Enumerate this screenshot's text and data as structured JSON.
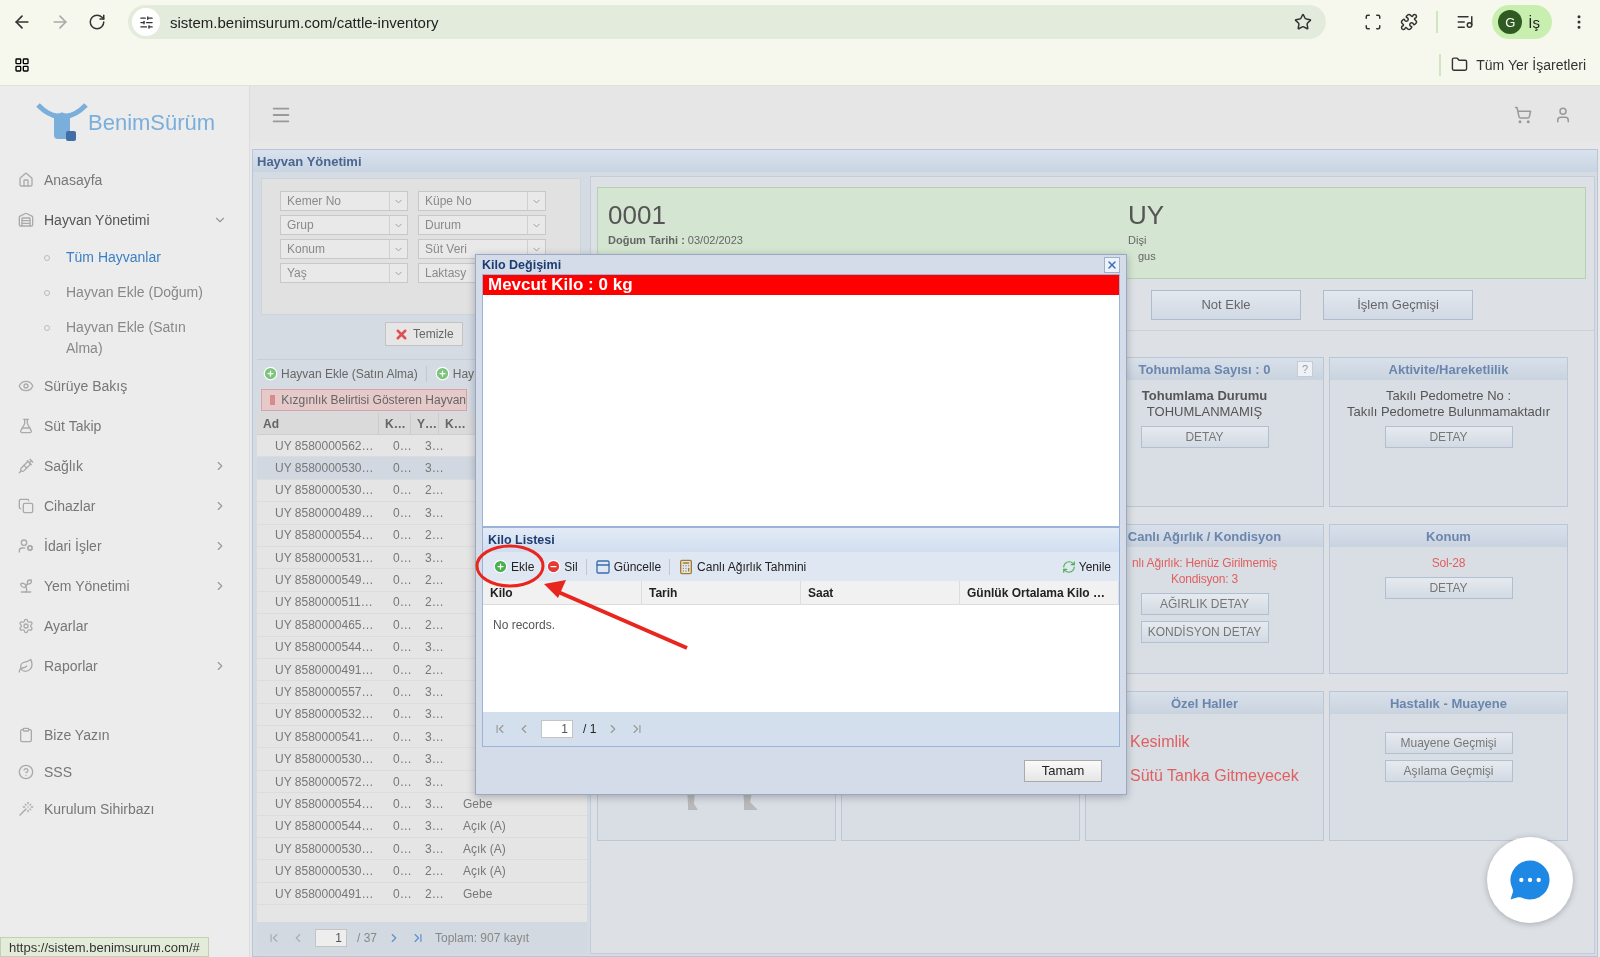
{
  "browser": {
    "url": "sistem.benimsurum.com/cattle-inventory",
    "profile_initial": "G",
    "profile_label": "İş",
    "bookmarks_folder": "Tüm Yer İşaretleri",
    "status_url": "https://sistem.benimsurum.com/#"
  },
  "logo": {
    "part_a": "Benim",
    "part_b": "Sürüm"
  },
  "sidebar": {
    "items": [
      {
        "kind": "link",
        "label": "Anasayfa"
      },
      {
        "kind": "group",
        "label": "Hayvan Yönetimi",
        "expanded": true,
        "children": [
          {
            "label": "Tüm Hayvanlar",
            "selected": true
          },
          {
            "label": "Hayvan Ekle (Doğum)",
            "selected": false
          },
          {
            "label": "Hayvan Ekle (Satın Alma)",
            "selected": false
          }
        ]
      },
      {
        "kind": "link",
        "label": "Sürüye Bakış"
      },
      {
        "kind": "link",
        "label": "Süt Takip"
      },
      {
        "kind": "group",
        "label": "Sağlık",
        "expanded": false
      },
      {
        "kind": "group",
        "label": "Cihazlar",
        "expanded": false
      },
      {
        "kind": "group",
        "label": "İdari İşler",
        "expanded": false
      },
      {
        "kind": "group",
        "label": "Yem Yönetimi",
        "expanded": false
      },
      {
        "kind": "link",
        "label": "Ayarlar"
      },
      {
        "kind": "group",
        "label": "Raporlar",
        "expanded": false
      }
    ],
    "footer_items": [
      "Bize Yazın",
      "SSS",
      "Kurulum Sihirbazı"
    ]
  },
  "panel": {
    "title": "Hayvan Yönetimi"
  },
  "filters": [
    {
      "placeholder": "Kemer No"
    },
    {
      "placeholder": "Küpe No"
    },
    {
      "placeholder": "Grup"
    },
    {
      "placeholder": "Durum"
    },
    {
      "placeholder": "Konum"
    },
    {
      "placeholder": "Süt Veri"
    },
    {
      "placeholder": "Yaş"
    },
    {
      "placeholder": "Laktasy"
    }
  ],
  "clear_button": "Temizle",
  "list_toolbar": [
    "Hayvan Ekle (Satın Alma)",
    "Hay"
  ],
  "legend": "Kızgınlık Belirtisi Gösteren Hayvan",
  "table": {
    "columns": [
      "Ad",
      "K…",
      "Y…",
      "K…"
    ],
    "rows": [
      {
        "selected": false,
        "cells": [
          "UY 8580000562…",
          "0…",
          "3…"
        ]
      },
      {
        "selected": true,
        "cells": [
          "UY 8580000530…",
          "0…",
          "3…"
        ]
      },
      {
        "selected": false,
        "cells": [
          "UY 8580000530…",
          "0…",
          "2…"
        ]
      },
      {
        "selected": false,
        "cells": [
          "UY 8580000489…",
          "0…",
          "3…"
        ]
      },
      {
        "selected": false,
        "cells": [
          "UY 8580000554…",
          "0…",
          "2…"
        ]
      },
      {
        "selected": false,
        "cells": [
          "UY 8580000531…",
          "0…",
          "3…"
        ]
      },
      {
        "selected": false,
        "cells": [
          "UY 8580000549…",
          "0…",
          "2…"
        ]
      },
      {
        "selected": false,
        "cells": [
          "UY 8580000511…",
          "0…",
          "2…"
        ]
      },
      {
        "selected": false,
        "cells": [
          "UY 8580000465…",
          "0…",
          "2…"
        ]
      },
      {
        "selected": false,
        "cells": [
          "UY 8580000544…",
          "0…",
          "3…"
        ]
      },
      {
        "selected": false,
        "cells": [
          "UY 8580000491…",
          "0…",
          "2…"
        ]
      },
      {
        "selected": false,
        "cells": [
          "UY 8580000557…",
          "0…",
          "3…"
        ]
      },
      {
        "selected": false,
        "cells": [
          "UY 8580000532…",
          "0…",
          "3…"
        ]
      },
      {
        "selected": false,
        "cells": [
          "UY 8580000541…",
          "0…",
          "3…"
        ]
      },
      {
        "selected": false,
        "cells": [
          "UY 8580000530…",
          "0…",
          "3…"
        ]
      },
      {
        "selected": false,
        "cells": [
          "UY 8580000572…",
          "0…",
          "3…"
        ]
      },
      {
        "selected": false,
        "cells": [
          "UY 8580000554…",
          "0…",
          "3…",
          "Gebe"
        ]
      },
      {
        "selected": false,
        "cells": [
          "UY 8580000544…",
          "0…",
          "3…",
          "Açık (A)"
        ]
      },
      {
        "selected": false,
        "cells": [
          "UY 8580000530…",
          "0…",
          "3…",
          "Açık (A)"
        ]
      },
      {
        "selected": false,
        "cells": [
          "UY 8580000530…",
          "0…",
          "2…",
          "Açık (A)"
        ]
      },
      {
        "selected": false,
        "cells": [
          "UY 8580000491…",
          "0…",
          "2…",
          "Gebe"
        ]
      }
    ],
    "pager": {
      "page": "1",
      "of": "/ 37",
      "summary": "Toplam: 907 kayıt"
    }
  },
  "animal": {
    "number": "0001",
    "birth_label": "Doğum Tarihi :",
    "birth_date": "03/02/2023",
    "tag": "UY",
    "sex": "Dişi",
    "line_3": "gus"
  },
  "actions": [
    "Not Ekle",
    "İşlem Geçmişi"
  ],
  "cards": [
    {
      "title": "Tohumlama Sayısı : 0",
      "help": "?",
      "list_style": false,
      "lines": [
        {
          "text": "Tohumlama Durumu",
          "bold": true,
          "warning": false
        },
        {
          "text": "TOHUMLANMAMIŞ",
          "bold": false,
          "warning": false
        }
      ],
      "buttons": [
        "DETAY"
      ]
    },
    {
      "title": "Aktivite/Hareketlilik",
      "list_style": false,
      "lines": [
        {
          "text": "Takılı Pedometre No :",
          "bold": false,
          "warning": false
        },
        {
          "text": "Takılı Pedometre Bulunmamaktadır",
          "bold": false,
          "warning": false
        }
      ],
      "buttons": [
        "DETAY"
      ]
    },
    {
      "title": "Canlı Ağırlık / Kondisyon",
      "list_style": false,
      "lines": [
        {
          "text": "nlı Ağırlık: Henüz Girilmemiş",
          "bold": false,
          "warning": true
        },
        {
          "text": "Kondisyon: 3",
          "bold": false,
          "warning": true
        }
      ],
      "buttons": [
        "AĞIRLIK DETAY",
        "KONDİSYON DETAY"
      ]
    },
    {
      "title": "Konum",
      "list_style": false,
      "lines": [
        {
          "text": "Sol-28",
          "bold": false,
          "warning": true
        }
      ],
      "buttons": [
        "DETAY"
      ]
    },
    {
      "title": "Özel Haller",
      "list_style": true,
      "lines": [
        {
          "text": "Kesimlik",
          "bold": false,
          "warning": true
        },
        {
          "text": "Sütü Tanka Gitmeyecek",
          "bold": false,
          "warning": true
        }
      ]
    },
    {
      "title": "Hastalık - Muayene",
      "list_style": false,
      "buttons": [
        "Muayene Geçmişi",
        "Aşılama Geçmişi"
      ]
    }
  ],
  "modal": {
    "title": "Kilo Değişimi",
    "current_weight": "Mevcut Kilo : 0 kg",
    "list_title": "Kilo Listesi",
    "toolbar": [
      {
        "kind": "add",
        "label": "Ekle"
      },
      {
        "kind": "delete",
        "label": "Sil"
      },
      {
        "kind": "update",
        "label": "Güncelle"
      },
      {
        "kind": "estimate",
        "label": "Canlı Ağırlık Tahmini"
      }
    ],
    "refresh": "Yenile",
    "columns": [
      "Kilo",
      "Tarih",
      "Saat",
      "Günlük Ortalama Kilo …"
    ],
    "empty": "No records.",
    "page": "1",
    "of": "/ 1",
    "ok": "Tamam"
  }
}
